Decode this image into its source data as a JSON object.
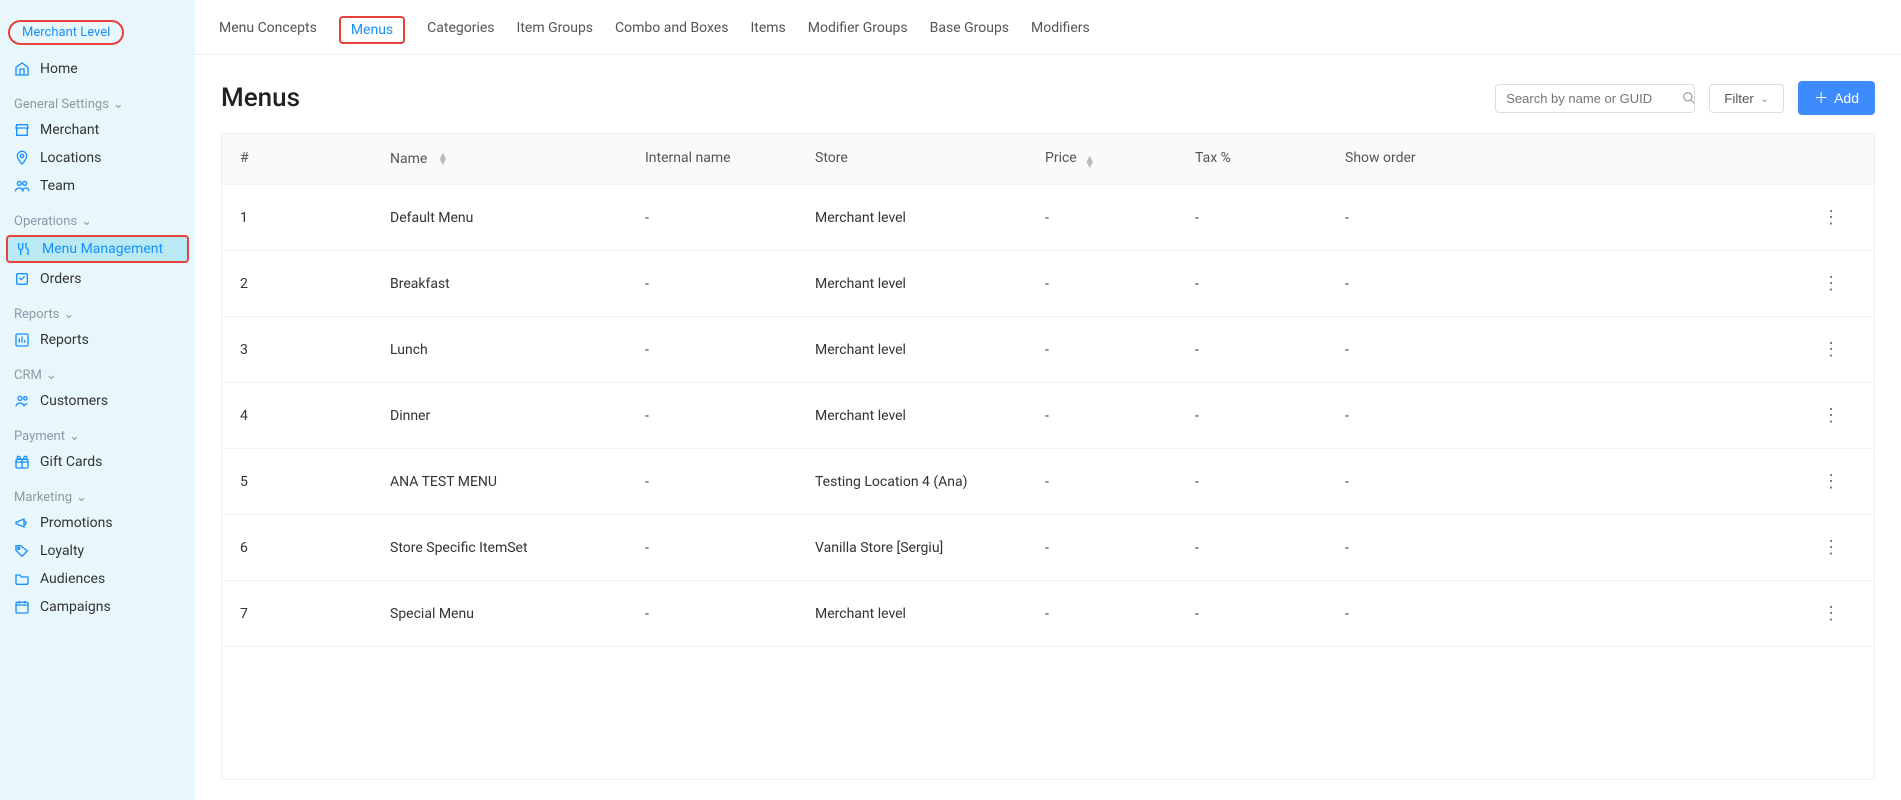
{
  "sidebar": {
    "badge": "Merchant Level",
    "home": "Home",
    "sections": {
      "general": {
        "label": "General Settings",
        "items": [
          "Merchant",
          "Locations",
          "Team"
        ]
      },
      "operations": {
        "label": "Operations",
        "items": [
          "Menu Management",
          "Orders"
        ]
      },
      "reports": {
        "label": "Reports",
        "items": [
          "Reports"
        ]
      },
      "crm": {
        "label": "CRM",
        "items": [
          "Customers"
        ]
      },
      "payment": {
        "label": "Payment",
        "items": [
          "Gift Cards"
        ]
      },
      "marketing": {
        "label": "Marketing",
        "items": [
          "Promotions",
          "Loyalty",
          "Audiences",
          "Campaigns"
        ]
      }
    }
  },
  "tabs": [
    "Menu Concepts",
    "Menus",
    "Categories",
    "Item Groups",
    "Combo and Boxes",
    "Items",
    "Modifier Groups",
    "Base Groups",
    "Modifiers"
  ],
  "active_tab_index": 1,
  "page": {
    "title": "Menus",
    "search_placeholder": "Search by name or GUID",
    "filter_label": "Filter",
    "add_label": "Add"
  },
  "table": {
    "columns": [
      "#",
      "Name",
      "Internal name",
      "Store",
      "Price",
      "Tax %",
      "Show order"
    ],
    "rows": [
      {
        "idx": "1",
        "name": "Default Menu",
        "internal": "-",
        "store": "Merchant level",
        "price": "-",
        "tax": "-",
        "order": "-"
      },
      {
        "idx": "2",
        "name": "Breakfast",
        "internal": "-",
        "store": "Merchant level",
        "price": "-",
        "tax": "-",
        "order": "-"
      },
      {
        "idx": "3",
        "name": "Lunch",
        "internal": "-",
        "store": "Merchant level",
        "price": "-",
        "tax": "-",
        "order": "-"
      },
      {
        "idx": "4",
        "name": "Dinner",
        "internal": "-",
        "store": "Merchant level",
        "price": "-",
        "tax": "-",
        "order": "-"
      },
      {
        "idx": "5",
        "name": "ANA TEST MENU",
        "internal": "-",
        "store": "Testing Location 4 (Ana)",
        "price": "-",
        "tax": "-",
        "order": "-"
      },
      {
        "idx": "6",
        "name": "Store Specific ItemSet",
        "internal": "-",
        "store": "Vanilla Store [Sergiu]",
        "price": "-",
        "tax": "-",
        "order": "-"
      },
      {
        "idx": "7",
        "name": "Special Menu",
        "internal": "-",
        "store": "Merchant level",
        "price": "-",
        "tax": "-",
        "order": "-"
      }
    ]
  }
}
